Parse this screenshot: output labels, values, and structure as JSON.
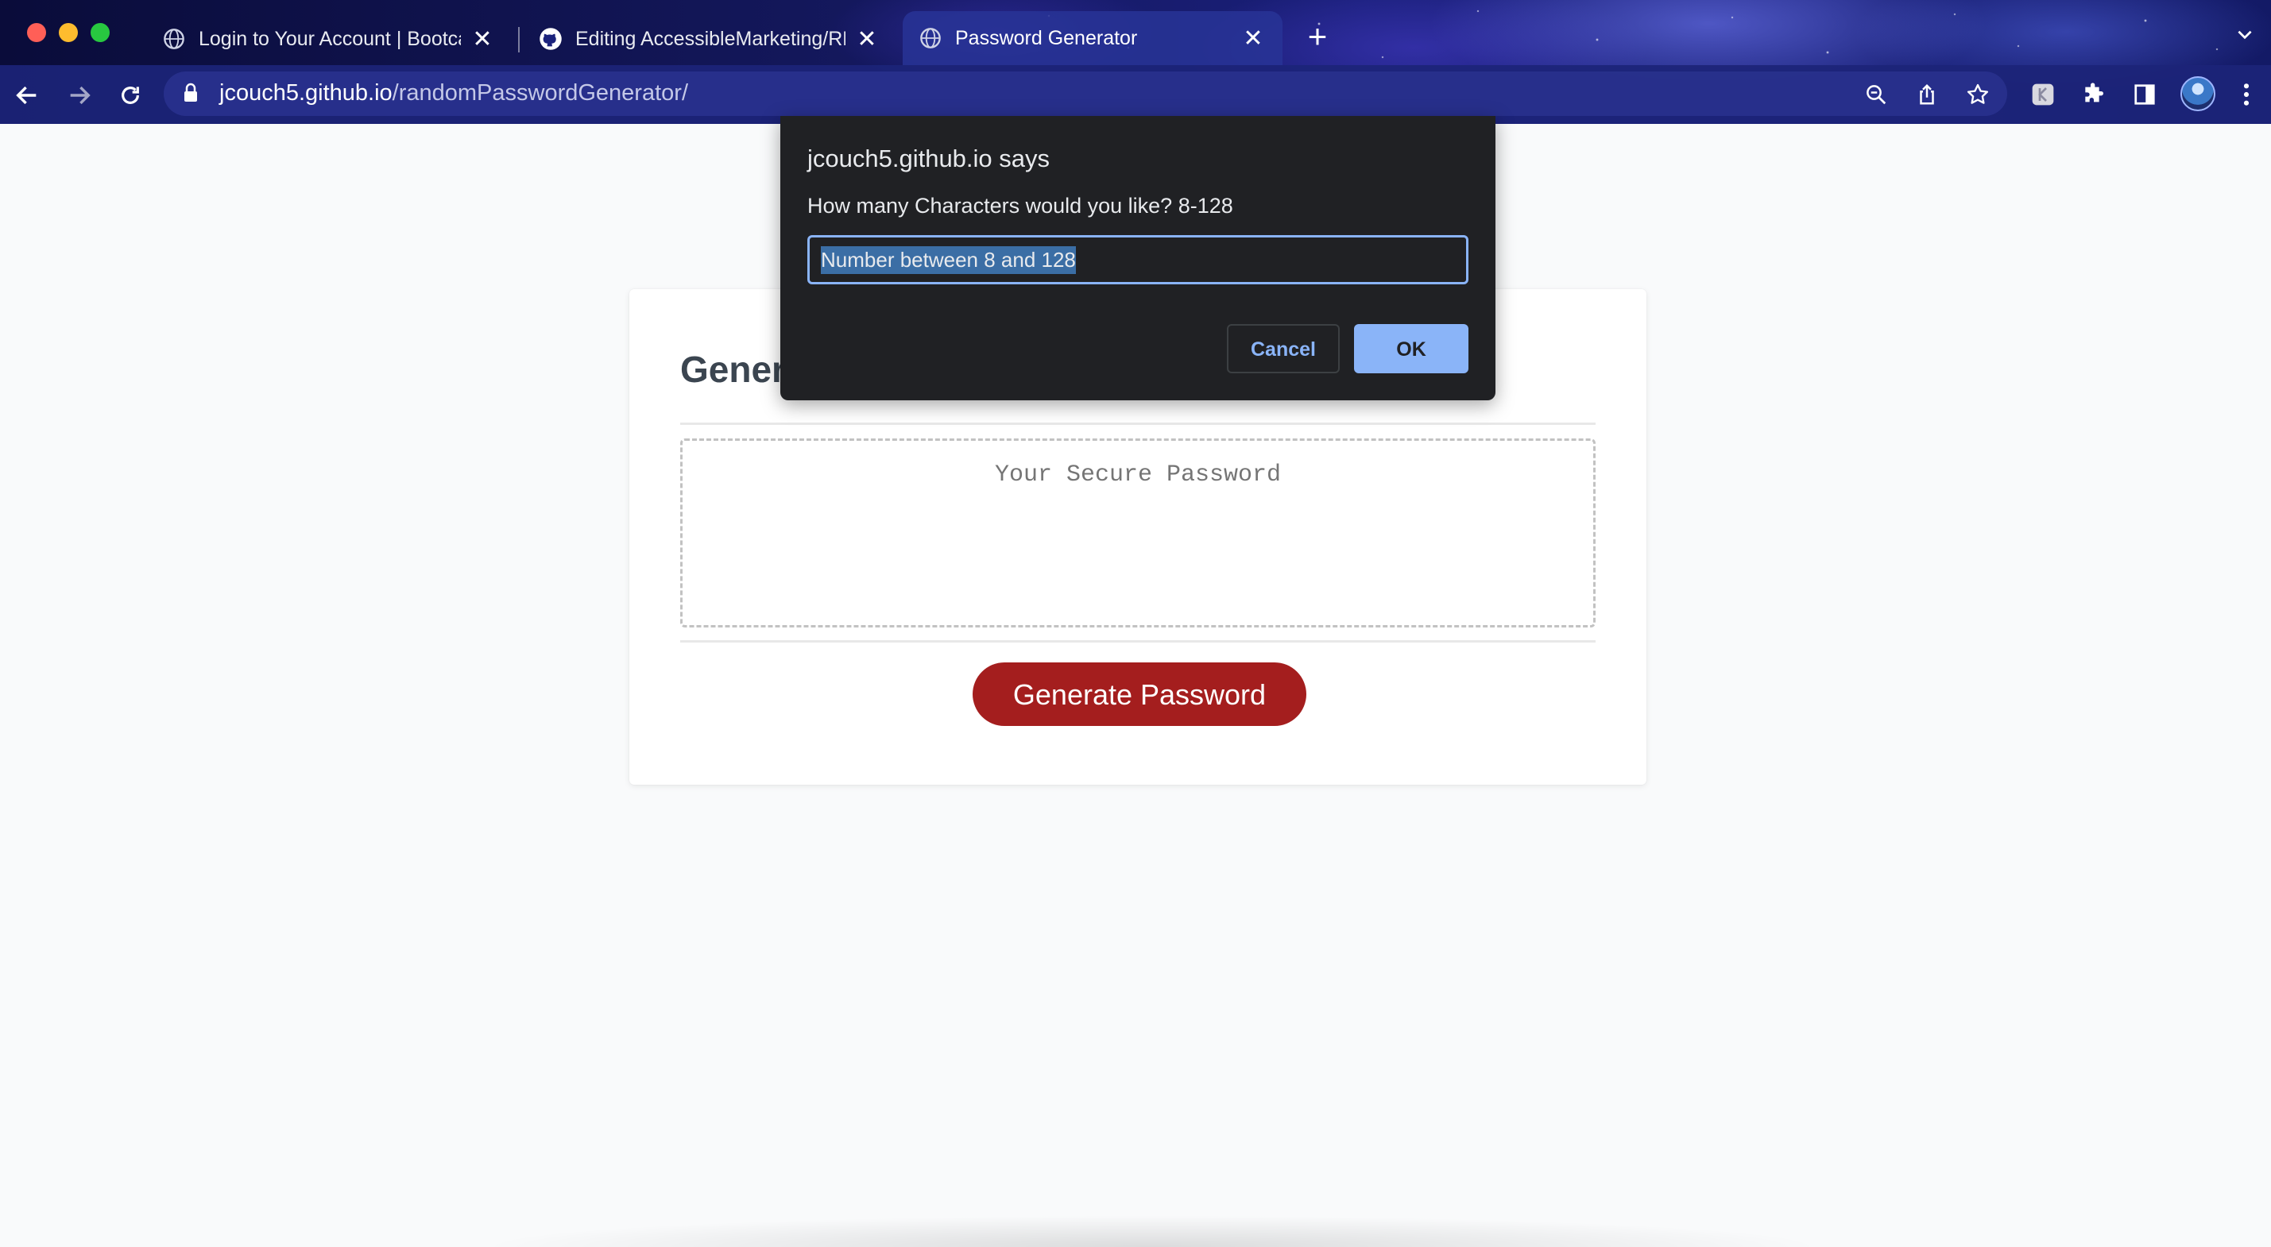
{
  "browser": {
    "tabs": [
      {
        "title": "Login to Your Account | Bootcamp",
        "favicon": "globe-icon",
        "active": false
      },
      {
        "title": "Editing AccessibleMarketing/README",
        "favicon": "github-icon",
        "active": false
      },
      {
        "title": "Password Generator",
        "favicon": "globe-icon",
        "active": true
      }
    ],
    "tab_close_glyph": "✕",
    "new_tab_glyph": "+",
    "url_host": "jcouch5.github.io",
    "url_path": "/randomPasswordGenerator/"
  },
  "page": {
    "header": "Generate a Password",
    "password_placeholder": "Your Secure Password",
    "generate_button": "Generate Password"
  },
  "dialog": {
    "title": "jcouch5.github.io says",
    "message": "How many Characters would you like? 8-128",
    "input_value": "Number between 8 and 128",
    "cancel_label": "Cancel",
    "ok_label": "OK"
  },
  "colors": {
    "accent_button": "#a41e1e",
    "dialog_bg": "#202124",
    "dialog_accent": "#8ab4f8"
  }
}
